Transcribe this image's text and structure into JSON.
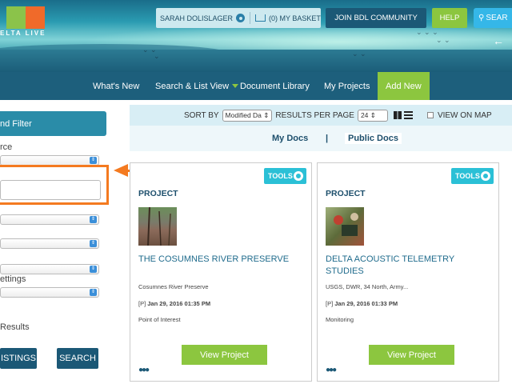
{
  "header": {
    "logo_text": "ELTA LIVE",
    "user_name": "SARAH DOLISLAGER",
    "basket_label": "(0) MY BASKET",
    "join_label": "JOIN BDL COMMUNITY",
    "help_label": "HELP",
    "search_label": "SEAR",
    "back_arrow": "←"
  },
  "nav": {
    "items": [
      "What's New",
      "Search & List View",
      "Document Library",
      "My Projects",
      "Add New"
    ]
  },
  "sidebar": {
    "title": "nd Filter",
    "source_label": "rce",
    "settings_label": "ettings",
    "results_label": "Results",
    "listings_button": "ISTINGS",
    "search_button": "SEARCH"
  },
  "sortbar": {
    "sort_by_label": "SORT BY",
    "sort_value": "Modified Da",
    "results_per_page_label": "RESULTS PER PAGE",
    "results_per_page_value": "24",
    "view_on_map_label": "VIEW ON MAP"
  },
  "docs": {
    "my_docs": "My Docs",
    "separator": "|",
    "public_docs": "Public Docs"
  },
  "cards": [
    {
      "tools_label": "TOOLS",
      "type": "PROJECT",
      "title": "THE COSUMNES RIVER PRESERVE",
      "subtitle": "Cosumnes River Preserve",
      "date_prefix": "[P]",
      "date": "Jan 29, 2016 01:35 PM",
      "category": "Point of Interest",
      "button": "View Project"
    },
    {
      "tools_label": "TOOLS",
      "type": "PROJECT",
      "title": "DELTA ACOUSTIC TELEMETRY STUDIES",
      "subtitle": "USGS, DWR, 34 North, Army...",
      "date_prefix": "[P]",
      "date": "Jan 29, 2016 01:33 PM",
      "category": "Monitoring",
      "button": "View Project"
    }
  ],
  "colors": {
    "nav_bg": "#1d5f7c",
    "accent_green": "#8cc63f",
    "highlight_orange": "#f47a20",
    "tools_teal": "#2bc0d6"
  }
}
